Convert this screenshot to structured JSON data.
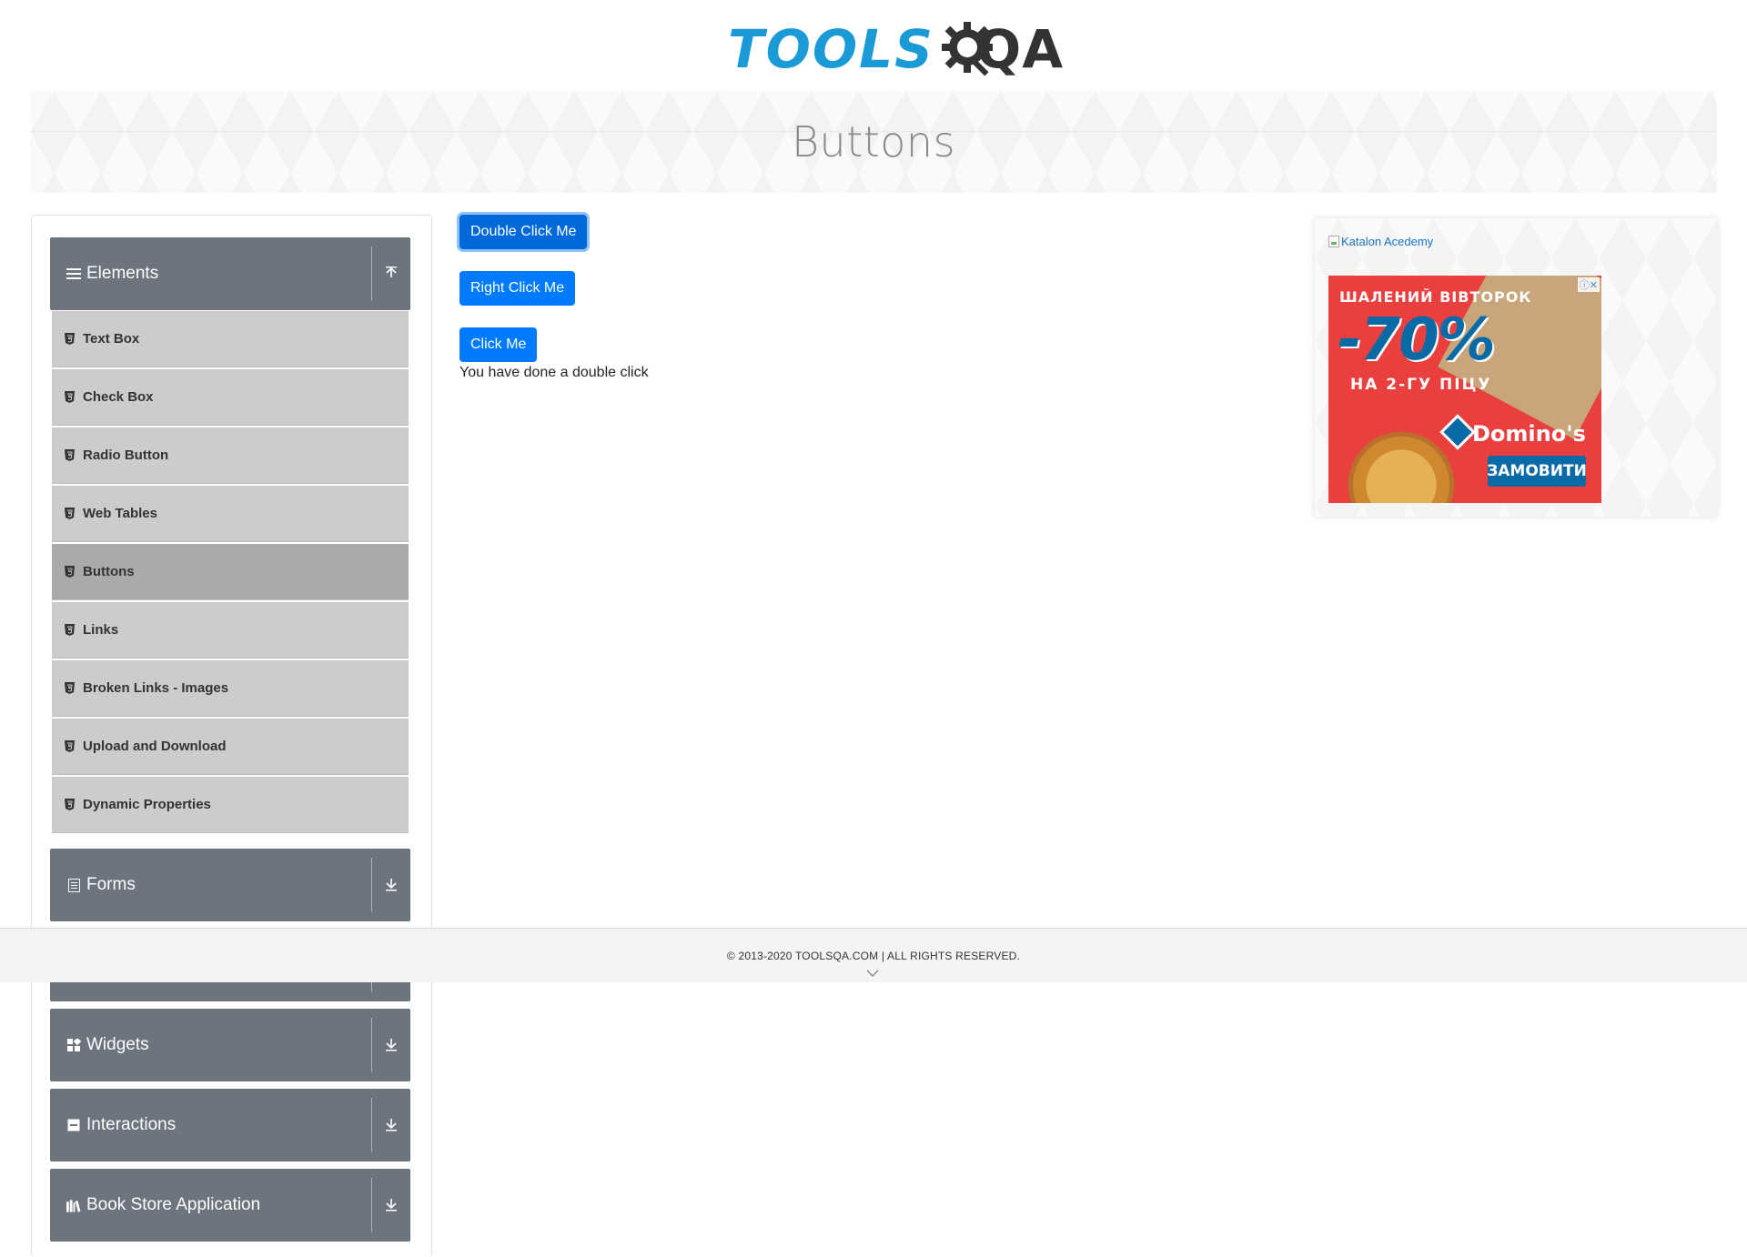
{
  "header": {
    "logo_tools": "TOOLS",
    "logo_qa": "QA"
  },
  "banner": {
    "title": "Buttons"
  },
  "sidebar": {
    "groups": [
      {
        "label": "Elements",
        "icon": "menu-icon",
        "arrow": "collapse-up-icon"
      },
      {
        "label": "Forms",
        "icon": "document-icon",
        "arrow": "expand-down-icon"
      },
      {
        "label": "Widgets",
        "icon": "grid-icon",
        "arrow": "expand-down-icon"
      },
      {
        "label": "Interactions",
        "icon": "window-icon",
        "arrow": "expand-down-icon"
      },
      {
        "label": "Book Store Application",
        "icon": "books-icon",
        "arrow": "expand-down-icon"
      }
    ],
    "items": [
      {
        "label": "Text Box"
      },
      {
        "label": "Check Box"
      },
      {
        "label": "Radio Button"
      },
      {
        "label": "Web Tables"
      },
      {
        "label": "Buttons",
        "active": true
      },
      {
        "label": "Links"
      },
      {
        "label": "Broken Links - Images"
      },
      {
        "label": "Upload and Download"
      },
      {
        "label": "Dynamic Properties"
      }
    ]
  },
  "main": {
    "double_click_label": "Double Click Me",
    "right_click_label": "Right Click Me",
    "click_label": "Click Me",
    "message": "You have done a double click"
  },
  "ad": {
    "link_text": "Katalon Acedemy",
    "promo_top": "ШАЛЕНИЙ ВІВТОРОК",
    "promo_big": "-70%",
    "promo_sub": "НА 2-ГУ ПІЦУ",
    "promo_brand": "Domino's",
    "promo_cta": "ЗАМОВИТИ",
    "promo_badge": "ⓘ✕"
  },
  "footer": {
    "copyright": "© 2013-2020 TOOLSQA.COM | ALL RIGHTS RESERVED."
  },
  "colors": {
    "primary": "#007bff",
    "sidebar_header": "#6c757d",
    "menu_item": "#cccccc",
    "menu_item_active": "#aaaaaa",
    "logo_blue": "#1a9ad6"
  }
}
